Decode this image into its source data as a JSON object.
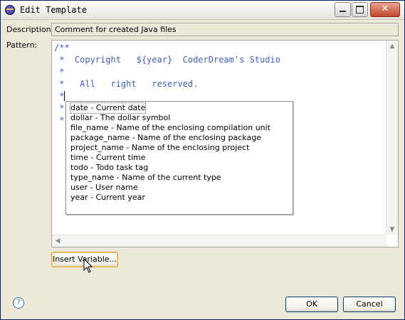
{
  "window": {
    "title": "Edit Template"
  },
  "form": {
    "description_label": "Description:",
    "description_value": "Comment for created Java files",
    "pattern_label": "Pattern:"
  },
  "editor": {
    "lines": [
      "/**",
      " *  Copyright   ${year}  CoderDream's Studio",
      " *",
      " *   All   right   reserved.",
      " *",
      " *",
      " *"
    ]
  },
  "variables_popup": {
    "items": [
      "date - Current date",
      "dollar - The dollar symbol",
      "file_name - Name of the enclosing compilation unit",
      "package_name - Name of the enclosing package",
      "project_name - Name of the enclosing project",
      "time - Current time",
      "todo - Todo task tag",
      "type_name - Name of the current type",
      "user - User name",
      "year - Current year"
    ],
    "selected_index": 0
  },
  "buttons": {
    "insert_variable": "Insert Variable...",
    "ok": "OK",
    "cancel": "Cancel"
  },
  "icons": {
    "help": "help-icon",
    "app": "eclipse-icon"
  }
}
